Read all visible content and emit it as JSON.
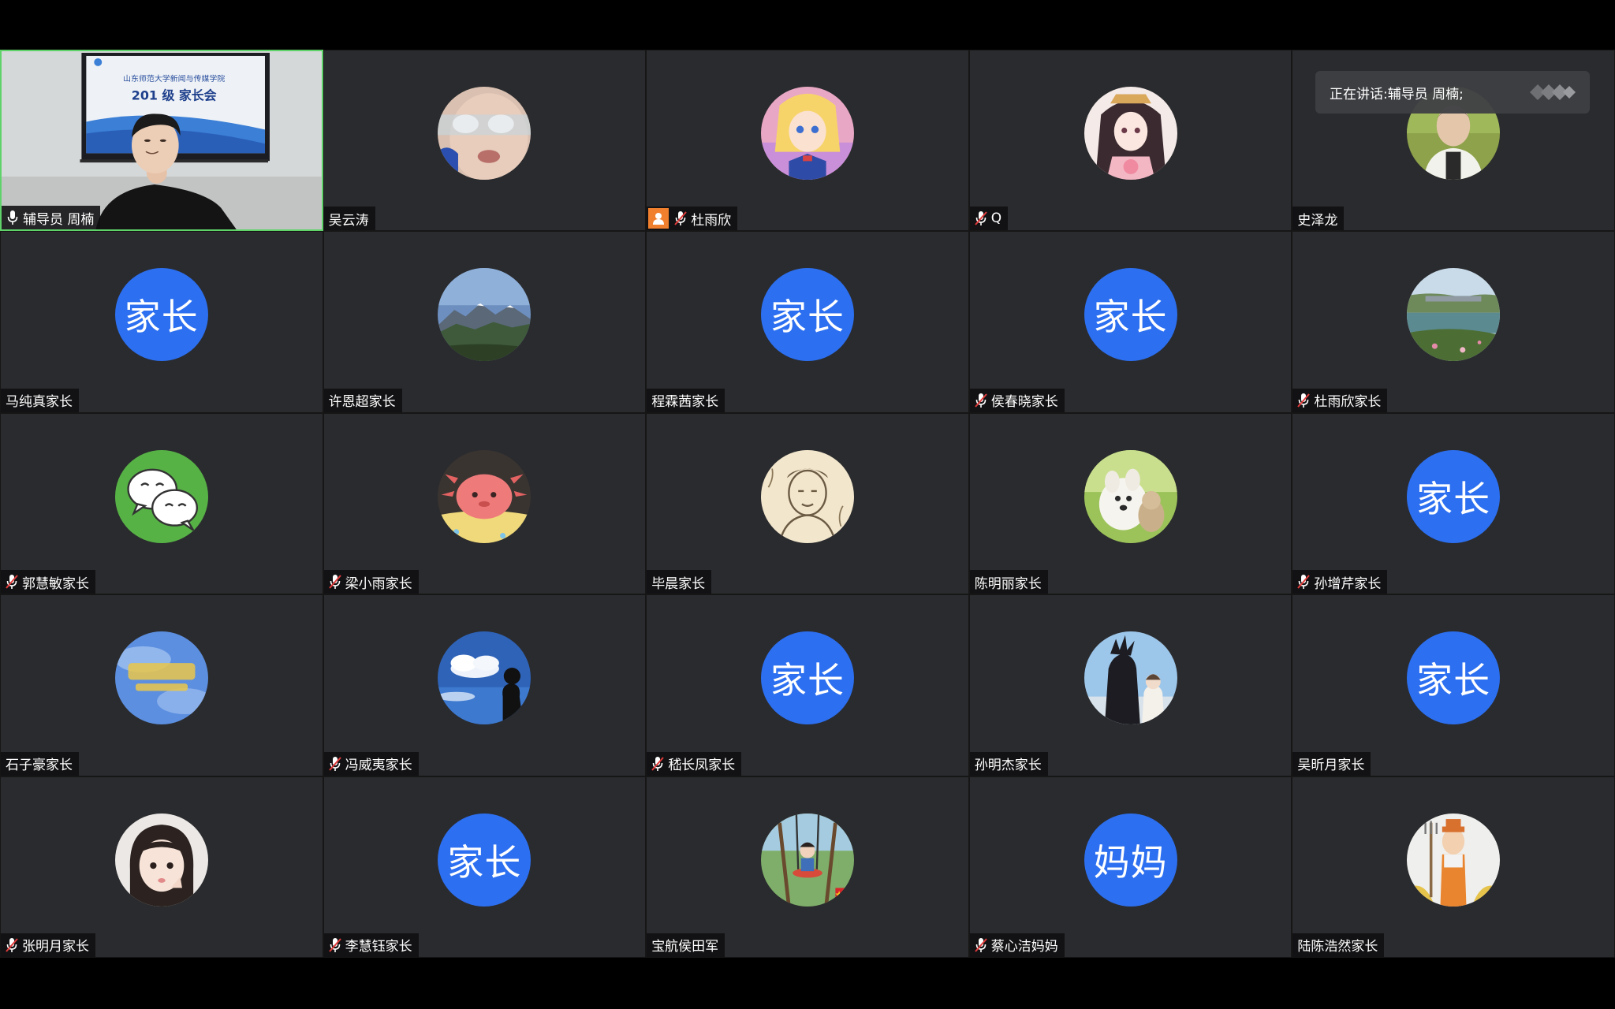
{
  "speaking_banner": {
    "prefix": "正在讲话: ",
    "speaker": "辅导员 周楠;"
  },
  "colors": {
    "accent_blue": "#2c6ff0",
    "active_border": "#5fd36a",
    "host_badge": "#f07f2e",
    "tile_bg": "#2a2b2e"
  },
  "speaker_video": {
    "screen_line1": "山东师范大学新闻与传媒学院",
    "screen_line2": "201 级 家长会"
  },
  "participants": [
    {
      "name": "辅导员 周楠",
      "mic": "on",
      "video": true
    },
    {
      "name": "吴云涛",
      "mic": "none",
      "avatar": "photo-face"
    },
    {
      "name": "杜雨欣",
      "mic": "muted",
      "host": true,
      "avatar": "anime-girl"
    },
    {
      "name": "Q",
      "mic": "muted",
      "avatar": "anime-lady"
    },
    {
      "name": "史泽龙",
      "mic": "none",
      "avatar": "photo-person"
    },
    {
      "name": "马纯真家长",
      "mic": "none",
      "avatar_text": "家长"
    },
    {
      "name": "许恩超家长",
      "mic": "none",
      "avatar": "mountains"
    },
    {
      "name": "程霖茜家长",
      "mic": "none",
      "avatar_text": "家长"
    },
    {
      "name": "侯春晓家长",
      "mic": "muted",
      "avatar_text": "家长"
    },
    {
      "name": "杜雨欣家长",
      "mic": "muted",
      "avatar": "river-town"
    },
    {
      "name": "郭慧敏家长",
      "mic": "muted",
      "avatar": "wechat-logo"
    },
    {
      "name": "梁小雨家长",
      "mic": "muted",
      "avatar": "pink-axolotl"
    },
    {
      "name": "毕晨家长",
      "mic": "none",
      "avatar": "sketch-portrait"
    },
    {
      "name": "陈明丽家长",
      "mic": "none",
      "avatar": "white-dog"
    },
    {
      "name": "孙增芹家长",
      "mic": "muted",
      "avatar_text": "家长"
    },
    {
      "name": "石子豪家长",
      "mic": "none",
      "avatar": "blue-sky-text"
    },
    {
      "name": "冯威夷家长",
      "mic": "muted",
      "avatar": "cloud-silhouette"
    },
    {
      "name": "嵇长凤家长",
      "mic": "muted",
      "avatar_text": "家长"
    },
    {
      "name": "孙明杰家长",
      "mic": "none",
      "avatar": "anime-duo"
    },
    {
      "name": "吴昕月家长",
      "mic": "none",
      "avatar_text": "家长"
    },
    {
      "name": "张明月家长",
      "mic": "muted",
      "avatar": "little-girl"
    },
    {
      "name": "李慧钰家长",
      "mic": "muted",
      "avatar_text": "家长"
    },
    {
      "name": "宝航侯田军",
      "mic": "none",
      "avatar": "child-swing"
    },
    {
      "name": "蔡心洁妈妈",
      "mic": "muted",
      "avatar_text": "妈妈"
    },
    {
      "name": "陆陈浩然家长",
      "mic": "none",
      "avatar": "farmer-cartoon"
    }
  ]
}
